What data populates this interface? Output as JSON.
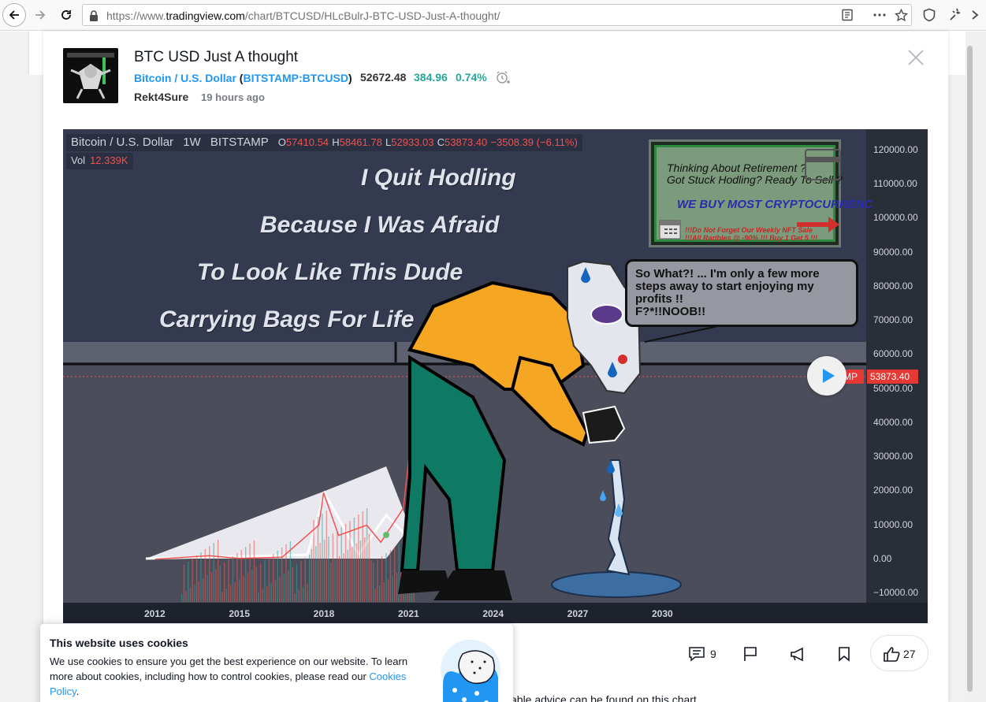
{
  "browser": {
    "url_prefix": "https://www.",
    "url_host": "tradingview.com",
    "url_path": "/chart/BTCUSD/HLcBulrJ-BTC-USD-Just-A-thought/"
  },
  "idea": {
    "title": "BTC USD Just A thought",
    "symbol_name": "Bitcoin / U.S. Dollar",
    "paren_open": "(",
    "symbol_ticker": "BITSTAMP:BTCUSD",
    "paren_close": ")",
    "price": "52672.48",
    "change": "384.96",
    "change_pct": "0.74%",
    "author": "Rekt4Sure",
    "time_ago": "19 hours ago"
  },
  "chart": {
    "legend": {
      "symbol": "Bitcoin / U.S. Dollar",
      "interval": "1W",
      "exchange": "BITSTAMP",
      "o_key": "O",
      "o_val": "57410.54",
      "h_key": "H",
      "h_val": "58461.78",
      "l_key": "L",
      "l_val": "52933.03",
      "c_key": "C",
      "c_val": "53873.40",
      "change": "−3508.39 (−6.11%)"
    },
    "volume": {
      "label": "Vol",
      "value": "12.339K"
    },
    "captions": [
      "I Quit Hodling",
      "Because I Was Afraid",
      "To  Look Like This Dude",
      "Carrying Bags For Life"
    ],
    "ad": {
      "line1": "Thinking About Retirement ?",
      "line2": "Got Stuck Hodling? Ready To Sell ?",
      "line3": "WE BUY MOST CRYPTOCURRENC",
      "line4": "!!!Do Not Forget Our Weekly  NFT Sale",
      "line5": "!!!All Raribles @ -90% !!! Buy 1 Get 5 !!!"
    },
    "bubble": "So What?! ... I'm only a few more\nsteps away to start enjoying my\nprofits !!\nF?*!!NOOB!!",
    "current_price_tag": "53873.40",
    "exchange_tag": "MP",
    "colors": {
      "bg": "#343a4f",
      "down": "#ef5350",
      "up": "#26a69a",
      "shirt": "#f5a623",
      "pants": "#0f7a63"
    }
  },
  "chart_data": {
    "type": "line",
    "title": "",
    "y_ticks": [
      "120000.00",
      "110000.00",
      "100000.00",
      "90000.00",
      "80000.00",
      "70000.00",
      "60000.00",
      "50000.00",
      "40000.00",
      "30000.00",
      "20000.00",
      "10000.00",
      "0.00",
      "−10000.00"
    ],
    "x_ticks": [
      "2012",
      "2015",
      "2018",
      "2021",
      "2024",
      "2027",
      "2030"
    ],
    "ylim": [
      -10000,
      120000
    ],
    "series": [
      {
        "x": [
          2012.0,
          2013.9,
          2015.0,
          2016.5,
          2017.8,
          2017.97,
          2018.5,
          2019.5,
          2020.0,
          2020.8,
          2021.0,
          2021.15,
          2021.25
        ],
        "values": [
          0,
          1000,
          250,
          600,
          10000,
          19500,
          7000,
          10000,
          5000,
          15000,
          30000,
          58000,
          53873
        ]
      }
    ]
  },
  "actions": {
    "comments": "9",
    "likes": "27",
    "desc_fragment": "able advice can be found on this chart"
  },
  "cookie": {
    "title": "This website uses cookies",
    "text": "We use cookies to ensure you get the best experience on our website. To learn more about cookies, including how to control cookies, please read our ",
    "link": "Cookies Policy",
    "after": "."
  }
}
